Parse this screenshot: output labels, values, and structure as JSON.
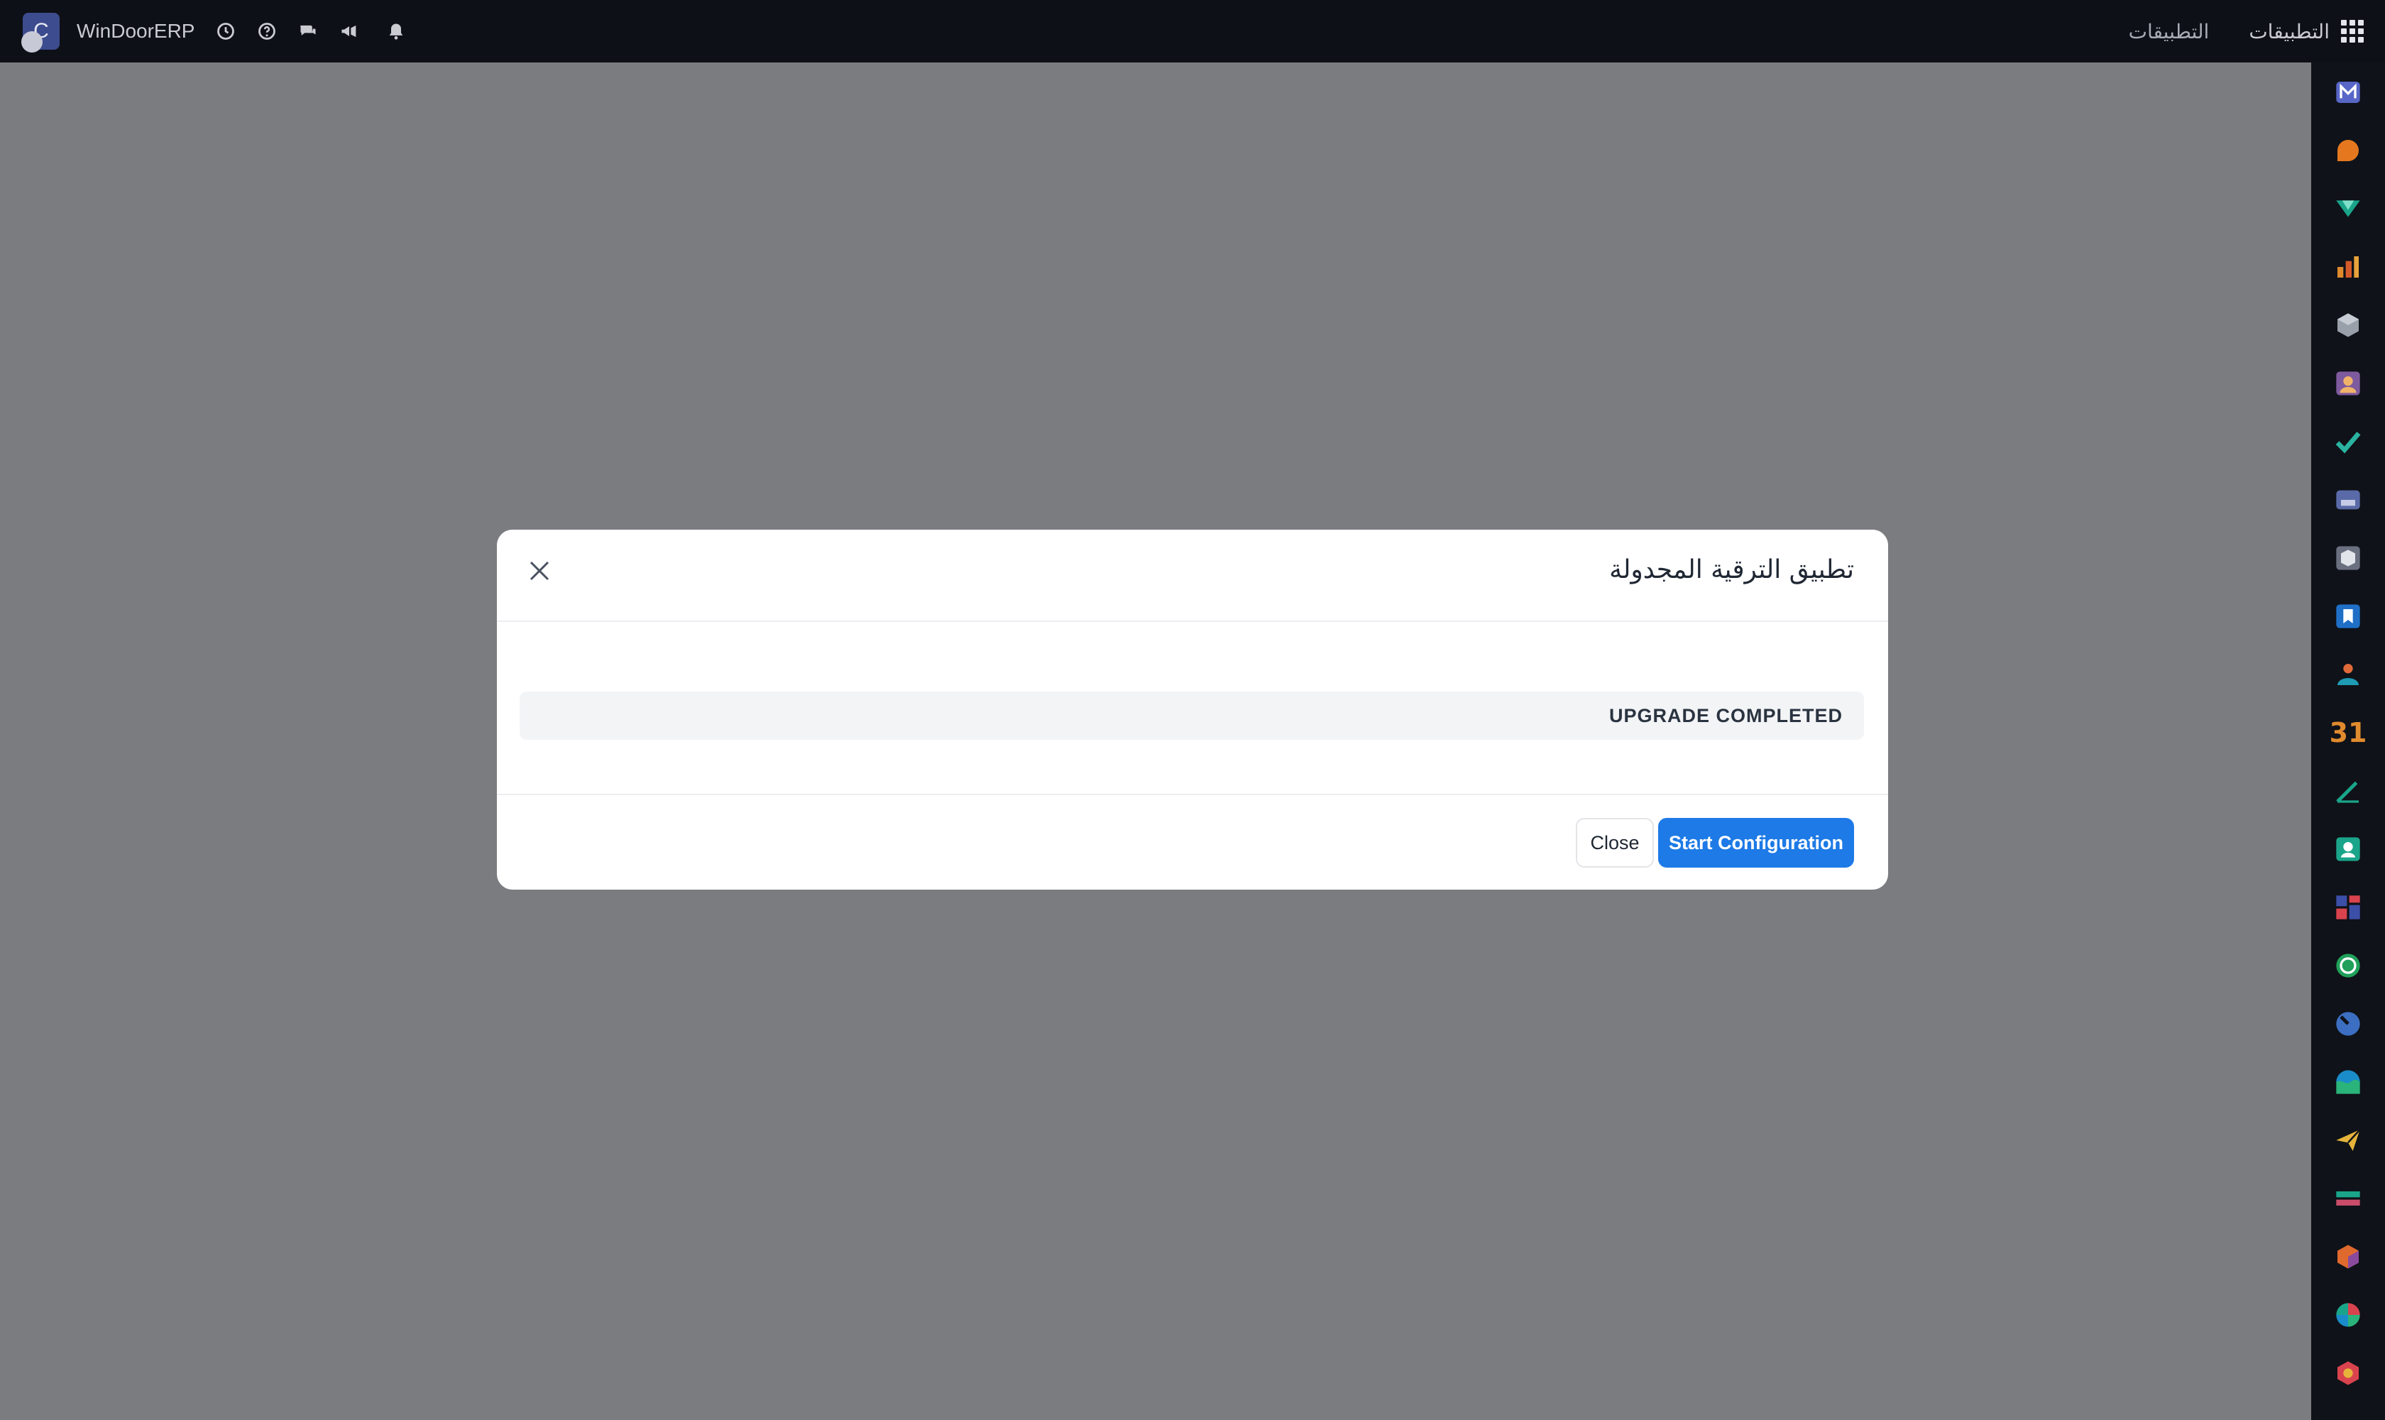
{
  "navbar": {
    "logo_letter": "C",
    "brand": "WinDoorERP",
    "apps_label": "التطبيقات",
    "apps_link_label": "التطبيقات"
  },
  "modal": {
    "title": "تطبيق الترقية المجدولة",
    "status_text": "UPGRADE COMPLETED",
    "close_label": "Close",
    "start_label": "Start Configuration"
  },
  "sidebar": {
    "calendar_number": "31"
  },
  "colors": {
    "navbar_bg": "#0d1017",
    "overlay": "#7b7c80",
    "primary_button": "#1d7ae6"
  }
}
